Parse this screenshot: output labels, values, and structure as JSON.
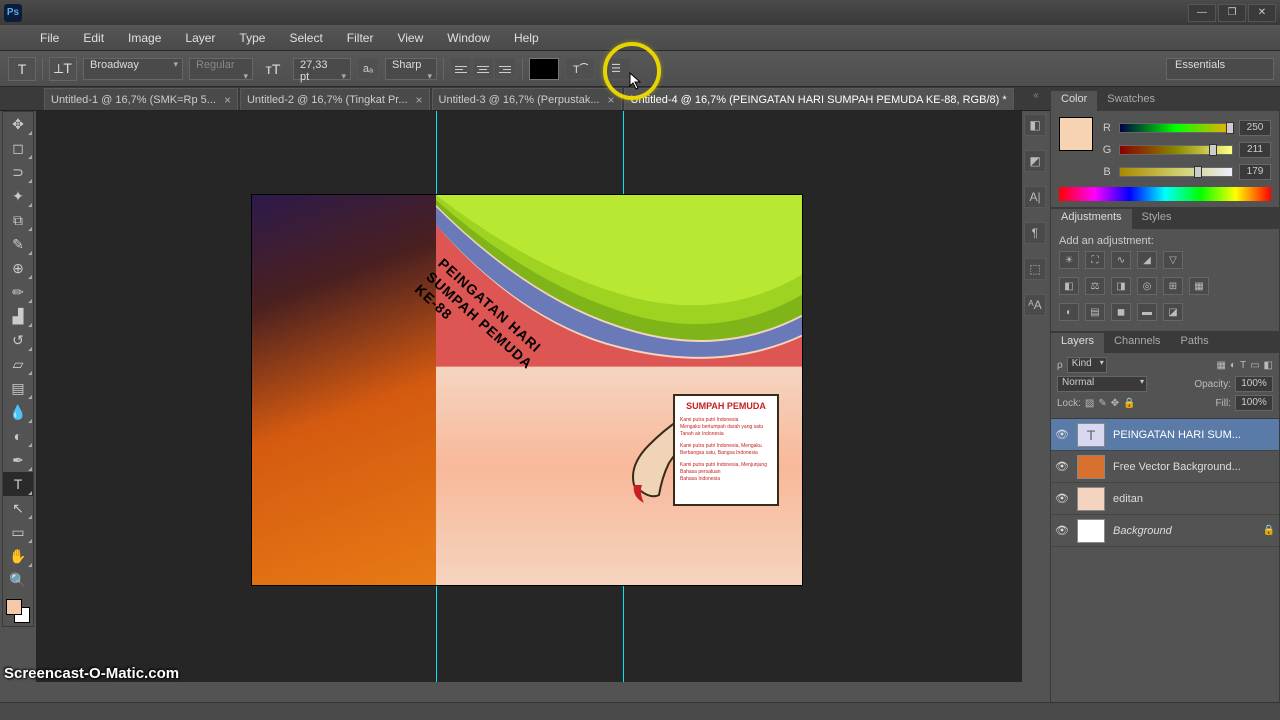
{
  "app": {
    "logo": "Ps"
  },
  "window_buttons": {
    "min": "—",
    "max": "❐",
    "close": "✕"
  },
  "menu": [
    "File",
    "Edit",
    "Image",
    "Layer",
    "Type",
    "Select",
    "Filter",
    "View",
    "Window",
    "Help"
  ],
  "options": {
    "font_family": "Broadway",
    "font_style": "Regular",
    "font_size": "27,33 pt",
    "aa": "Sharp",
    "workspace": "Essentials"
  },
  "tabs": [
    {
      "label": "Untitled-1 @ 16,7% (SMK=Rp 5...",
      "active": false
    },
    {
      "label": "Untitled-2 @ 16,7% (Tingkat Pr...",
      "active": false
    },
    {
      "label": "Untitled-3 @ 16,7% (Perpustak...",
      "active": false
    },
    {
      "label": "Untitled-4 @ 16,7% (PEINGATAN HARI SUMPAH PEMUDA KE-88, RGB/8) *",
      "active": true
    }
  ],
  "canvas_text": {
    "line1": "PEINGATAN HARI",
    "line2": "SUMPAH PEMUDA",
    "line3": "KE-88",
    "scroll_title": "SUMPAH PEMUDA",
    "scroll_l1": "Kami putra putri Indonesia",
    "scroll_l2": "Mengaku bertumpah darah yang satu",
    "scroll_l3": "Tanah air Indonesia",
    "scroll_l4": "Kami putra putri Indonesia, Mengaku",
    "scroll_l5": "Berbangsa satu, Bangsa Indonesia",
    "scroll_l6": "Kami putra putri Indonesia, Menjunjung",
    "scroll_l7": "Bahasa persatuan",
    "scroll_l8": "Bahasa Indonesia"
  },
  "color_panel": {
    "tab1": "Color",
    "tab2": "Swatches",
    "r_label": "R",
    "r_val": "250",
    "g_label": "G",
    "g_val": "211",
    "b_label": "B",
    "b_val": "179"
  },
  "adjustments": {
    "tab1": "Adjustments",
    "tab2": "Styles",
    "hint": "Add an adjustment:"
  },
  "layers_panel": {
    "tab1": "Layers",
    "tab2": "Channels",
    "tab3": "Paths",
    "kind": "Kind",
    "blend": "Normal",
    "opacity_label": "Opacity:",
    "opacity_val": "100%",
    "lock_label": "Lock:",
    "fill_label": "Fill:",
    "fill_val": "100%",
    "layers": [
      {
        "name": "PEINGATAN HARI SUM...",
        "selected": true,
        "thumb": "#d8d8f0",
        "type": "text"
      },
      {
        "name": "Free Vector Background...",
        "selected": false,
        "thumb": "#d87030"
      },
      {
        "name": "editan",
        "selected": false,
        "thumb": "#f5d4bf"
      },
      {
        "name": "Background",
        "selected": false,
        "thumb": "#ffffff",
        "locked": true,
        "italic": true
      }
    ]
  },
  "watermark": "Screencast-O-Matic.com"
}
